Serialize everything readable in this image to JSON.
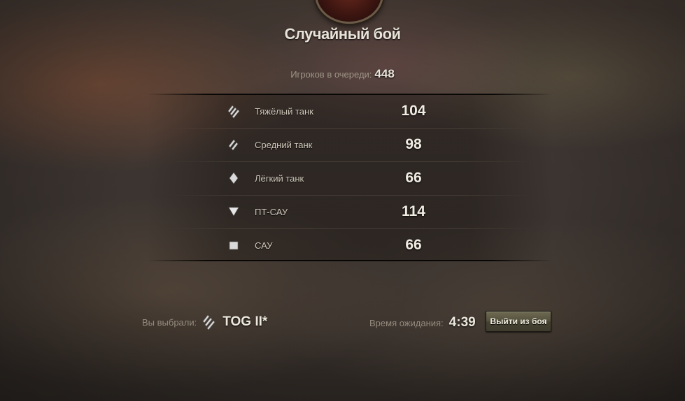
{
  "header": {
    "title": "Случайный бой",
    "queue_label": "Игроков в очереди:",
    "queue_total": "448"
  },
  "queue_table": {
    "rows": [
      {
        "icon": "heavy-tank-icon",
        "label": "Тяжёлый танк",
        "count": "104"
      },
      {
        "icon": "medium-tank-icon",
        "label": "Средний танк",
        "count": "98"
      },
      {
        "icon": "light-tank-icon",
        "label": "Лёгкий танк",
        "count": "66"
      },
      {
        "icon": "tank-destroyer-icon",
        "label": "ПТ-САУ",
        "count": "114"
      },
      {
        "icon": "spg-icon",
        "label": "САУ",
        "count": "66"
      }
    ]
  },
  "footer": {
    "selected_label": "Вы выбрали:",
    "selected_icon": "heavy-tank-icon",
    "selected_tank": "TOG II*",
    "wait_label": "Время ожидания:",
    "wait_time": "4:39",
    "exit_button": "Выйти из боя"
  },
  "colors": {
    "accent_button": "#56533f",
    "text_primary": "#f0ece2",
    "text_secondary": "#958b7e"
  }
}
